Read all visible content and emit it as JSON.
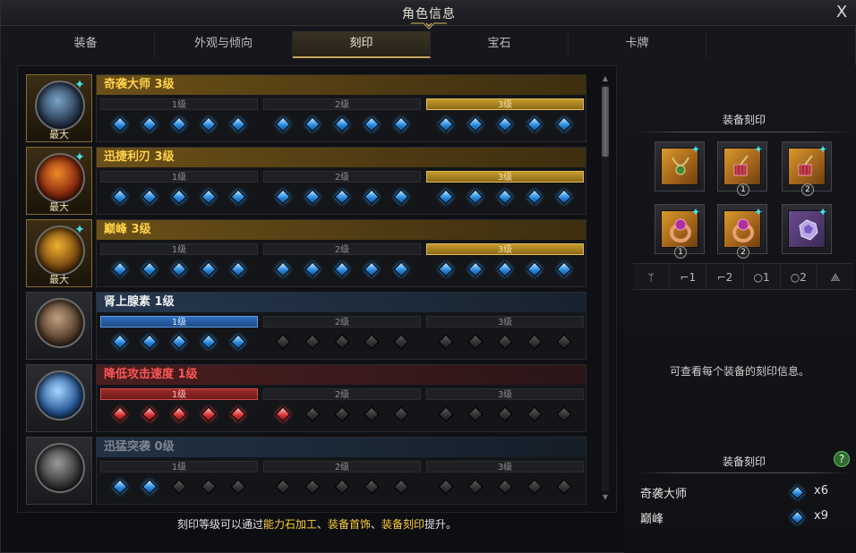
{
  "window": {
    "title": "角色信息",
    "close_label": "X"
  },
  "tabs": [
    {
      "label": "装备",
      "active": false
    },
    {
      "label": "外观与倾向",
      "active": false
    },
    {
      "label": "刻印",
      "active": true
    },
    {
      "label": "宝石",
      "active": false
    },
    {
      "label": "卡牌",
      "active": false
    }
  ],
  "engravings": [
    {
      "name": "奇袭大师 3级",
      "style": "gold",
      "max_label": "最大",
      "levels": [
        "1级",
        "2级",
        "3级"
      ],
      "active_level": 3,
      "active_color": "gold",
      "gems": [
        [
          "blue",
          "blue",
          "blue",
          "blue",
          "blue"
        ],
        [
          "blue",
          "blue",
          "blue",
          "blue",
          "blue"
        ],
        [
          "blue",
          "blue",
          "blue",
          "blue",
          "blue"
        ]
      ]
    },
    {
      "name": "迅捷利刃 3级",
      "style": "gold",
      "max_label": "最大",
      "levels": [
        "1级",
        "2级",
        "3级"
      ],
      "active_level": 3,
      "active_color": "gold",
      "gems": [
        [
          "blue",
          "blue",
          "blue",
          "blue",
          "blue"
        ],
        [
          "blue",
          "blue",
          "blue",
          "blue",
          "blue"
        ],
        [
          "blue",
          "blue",
          "blue",
          "blue",
          "blue"
        ]
      ]
    },
    {
      "name": "巅峰 3级",
      "style": "gold",
      "max_label": "最大",
      "levels": [
        "1级",
        "2级",
        "3级"
      ],
      "active_level": 3,
      "active_color": "gold",
      "gems": [
        [
          "blue",
          "blue",
          "blue",
          "blue",
          "blue"
        ],
        [
          "blue",
          "blue",
          "blue",
          "blue",
          "blue"
        ],
        [
          "blue",
          "blue",
          "blue",
          "blue",
          "blue"
        ]
      ]
    },
    {
      "name": "肾上腺素 1级",
      "style": "blue",
      "max_label": "",
      "levels": [
        "1级",
        "2级",
        "3级"
      ],
      "active_level": 1,
      "active_color": "blue",
      "gems": [
        [
          "blue",
          "blue",
          "blue",
          "blue",
          "blue"
        ],
        [
          "empty",
          "empty",
          "empty",
          "empty",
          "empty"
        ],
        [
          "empty",
          "empty",
          "empty",
          "empty",
          "empty"
        ]
      ]
    },
    {
      "name": "降低攻击速度 1级",
      "style": "red",
      "max_label": "",
      "levels": [
        "1级",
        "2级",
        "3级"
      ],
      "active_level": 1,
      "active_color": "red",
      "gems": [
        [
          "red",
          "red",
          "red",
          "red",
          "red"
        ],
        [
          "red",
          "empty",
          "empty",
          "empty",
          "empty"
        ],
        [
          "empty",
          "empty",
          "empty",
          "empty",
          "empty"
        ]
      ]
    },
    {
      "name": "迅猛突袭 0级",
      "style": "dim",
      "max_label": "",
      "levels": [
        "1级",
        "2级",
        "3级"
      ],
      "active_level": 0,
      "active_color": "none",
      "gems": [
        [
          "blue",
          "blue",
          "empty",
          "empty",
          "empty"
        ],
        [
          "empty",
          "empty",
          "empty",
          "empty",
          "empty"
        ],
        [
          "empty",
          "empty",
          "empty",
          "empty",
          "empty"
        ]
      ]
    }
  ],
  "footer": {
    "prefix": "刻印等级可以通过",
    "hl1": "能力石加工",
    "sep1": "、",
    "hl2": "装备首饰",
    "sep2": "、",
    "hl3": "装备刻印",
    "suffix": "提升。"
  },
  "right": {
    "equip_title": "装备刻印",
    "equipment": [
      {
        "icon": "necklace-icon",
        "badge": ""
      },
      {
        "icon": "earring-icon",
        "badge": "1"
      },
      {
        "icon": "earring-icon",
        "badge": "2"
      },
      {
        "icon": "ring-icon",
        "badge": "1"
      },
      {
        "icon": "ring-icon",
        "badge": "2"
      },
      {
        "icon": "ability-stone-icon",
        "badge": ""
      }
    ],
    "type_strip": [
      "ᛘ",
      "⌐1",
      "⌐2",
      "○1",
      "○2",
      "⟁"
    ],
    "info_text": "可查看每个装备的刻印信息。",
    "summary_title": "装备刻印",
    "help_label": "?",
    "summary": [
      {
        "name": "奇袭大师",
        "count": "x6"
      },
      {
        "name": "巅峰",
        "count": "x9"
      }
    ]
  },
  "colors": {
    "accent_gold": "#c8a55a",
    "gem_cyan": "#46e2e6",
    "penalty_red": "#ff5656"
  }
}
